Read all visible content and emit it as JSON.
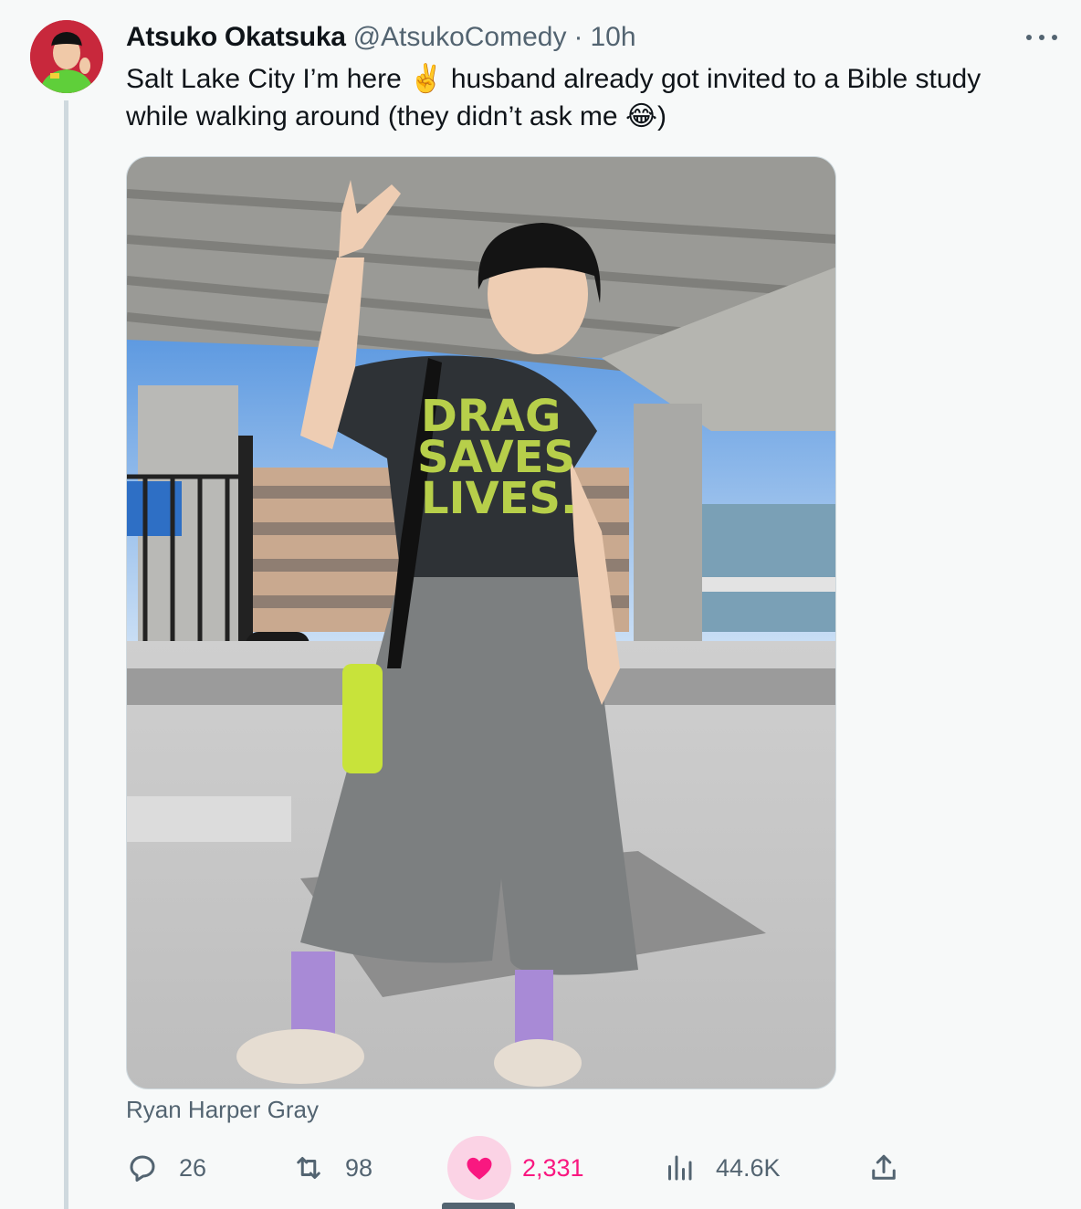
{
  "author": {
    "display_name": "Atsuko Okatsuka",
    "handle": "@AtsukoComedy",
    "separator": "·",
    "time": "10h"
  },
  "tweet": {
    "line1_a": "Salt Lake City I’m here ",
    "emoji_peace": "✌️",
    "line1_b": " husband already got invited to a Bible study while walking around (they didn’t ask me ",
    "emoji_laugh": "😂",
    "line1_c": ")"
  },
  "media": {
    "shirt_text_1": "DRAG",
    "shirt_text_2": "SAVES",
    "shirt_text_3": "LIVES."
  },
  "photo_credit": "Ryan Harper Gray",
  "actions": {
    "replies": "26",
    "reposts": "98",
    "likes": "2,331",
    "views": "44.6K"
  },
  "colors": {
    "like": "#f91880",
    "muted": "#536471",
    "text": "#0f1419"
  }
}
